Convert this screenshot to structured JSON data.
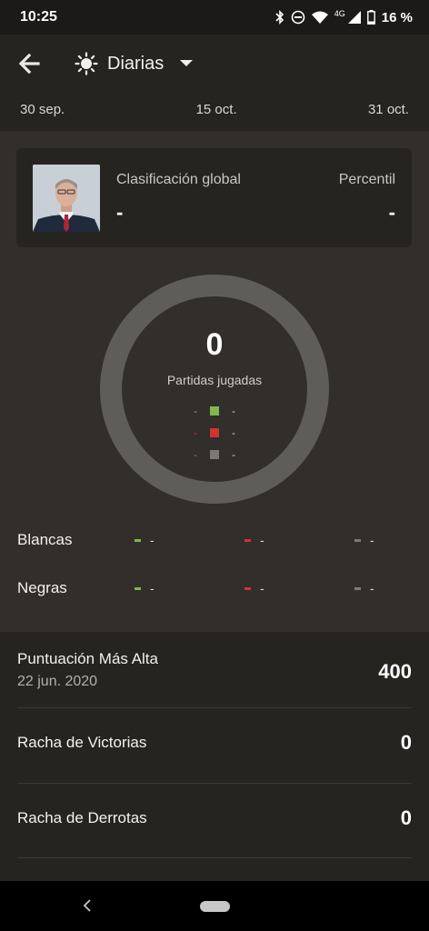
{
  "status_bar": {
    "time": "10:25",
    "network": "4G",
    "battery": "16 %"
  },
  "header": {
    "period": "Diarias",
    "dates": [
      "30 sep.",
      "15 oct.",
      "31 oct."
    ]
  },
  "ranking": {
    "global_label": "Clasificación global",
    "global_value": "-",
    "percentile_label": "Percentil",
    "percentile_value": "-"
  },
  "games": {
    "count": "0",
    "caption": "Partidas jugadas",
    "legend": [
      {
        "value": "-",
        "count": "-",
        "color": "#81b64c"
      },
      {
        "value": "-",
        "count": "-",
        "color": "#d0342c"
      },
      {
        "value": "-",
        "count": "-",
        "color": "#7b7977"
      }
    ]
  },
  "by_color": [
    {
      "label": "Blancas",
      "win": "-",
      "loss": "-",
      "draw": "-"
    },
    {
      "label": "Negras",
      "win": "-",
      "loss": "-",
      "draw": "-"
    }
  ],
  "colors": {
    "win": "#81b64c",
    "loss": "#d0342c",
    "draw": "#7b7977"
  },
  "records": [
    {
      "title": "Puntuación Más Alta",
      "subtitle": "22 jun. 2020",
      "value": "400"
    },
    {
      "title": "Racha de Victorias",
      "value": "0"
    },
    {
      "title": "Racha de Derrotas",
      "value": "0"
    }
  ]
}
